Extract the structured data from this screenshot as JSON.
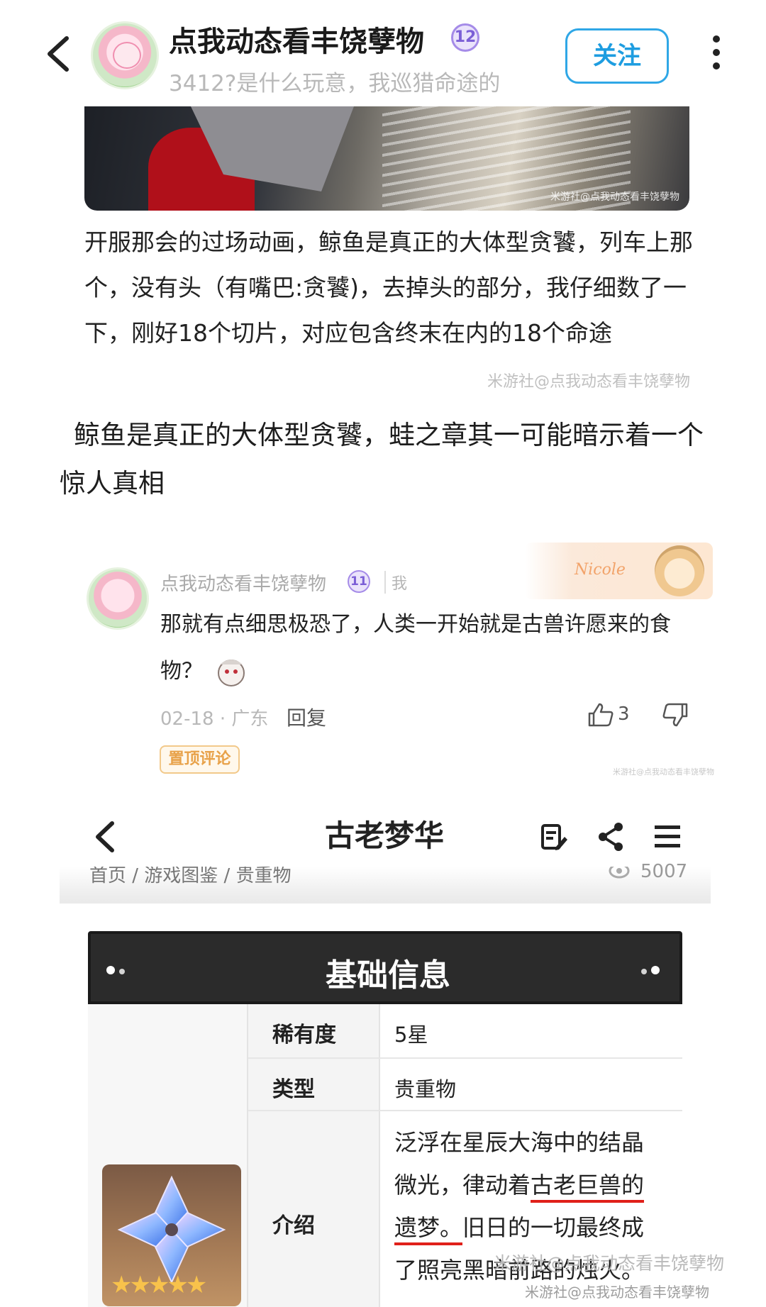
{
  "header": {
    "author_name": "点我动态看丰饶孽物",
    "level": "12",
    "signature": "3412?是什么玩意，我巡猎命途的",
    "follow_label": "关注"
  },
  "image": {
    "watermark": "米游社@点我动态看丰饶孽物"
  },
  "quote": {
    "text": "开服那会的过场动画，鲸鱼是真正的大体型贪饕，列车上那个，没有头（有嘴巴:贪饕)，去掉头的部分，我仔细数了一下，刚好18个切片，对应包含终末在内的18个命途",
    "watermark": "米游社@点我动态看丰饶孽物"
  },
  "post": {
    "text": "鲸鱼是真正的大体型贪饕，蛙之章其一可能暗示着一个惊人真相"
  },
  "comment": {
    "author_name": "点我动态看丰饶孽物",
    "level": "11",
    "me_label": "我",
    "banner_text": "Nicole",
    "text": "那就有点细思极恐了，人类一开始就是古兽许愿来的食物？",
    "date_location": "02-18 · 广东",
    "reply_label": "回复",
    "like_count": "3",
    "pinned_label": "置顶评论",
    "watermark": "米游社@点我动态看丰饶孽物"
  },
  "wiki": {
    "title": "古老梦华",
    "breadcrumb": "首页 / 游戏图鉴 / 贵重物",
    "views": "5007",
    "card_title": "基础信息",
    "rows": [
      {
        "key": "稀有度",
        "value": "5星"
      },
      {
        "key": "类型",
        "value": "贵重物"
      },
      {
        "key": "介绍",
        "value_part1": "泛浮在星辰大海中的结晶微光，律动着",
        "value_highlight": "古老巨兽的遗梦。",
        "value_part2": "旧日的一切最终成了照亮黑暗前路的烛火。"
      }
    ],
    "stars": "★★★★★"
  },
  "watermarks": {
    "bottom1": "米游社@点我动态看丰饶孽物",
    "bottom2": "米游社@点我动态看丰饶孽物"
  },
  "colors": {
    "follow_accent": "#2fa7e6",
    "level_badge": "#a58be8",
    "pinned_badge": "#e8a24a",
    "underline": "#e0201a"
  }
}
